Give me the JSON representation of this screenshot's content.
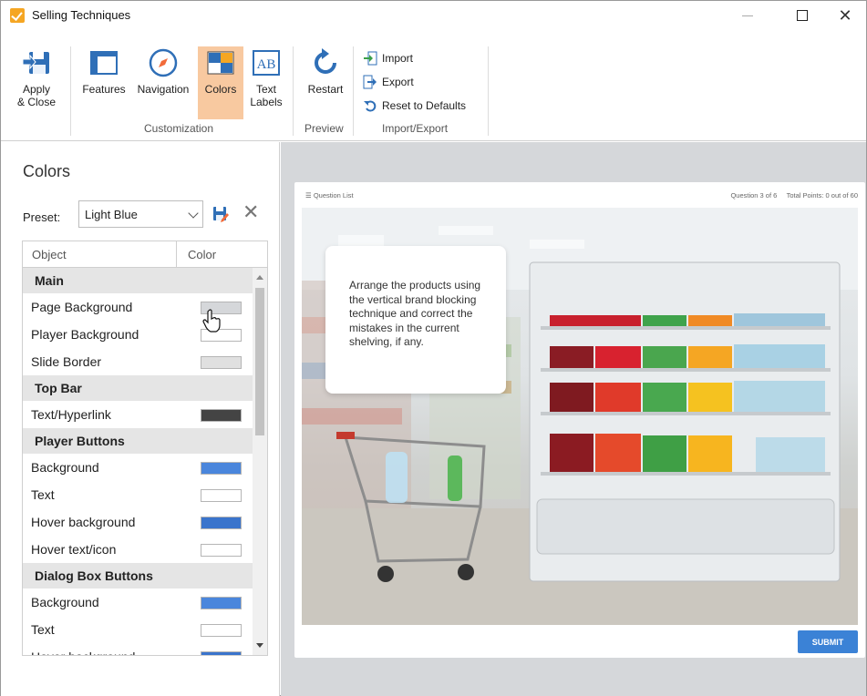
{
  "window": {
    "title": "Selling Techniques"
  },
  "ribbon": {
    "apply_close": "Apply\n& Close",
    "features": "Features",
    "navigation": "Navigation",
    "colors": "Colors",
    "text_labels": "Text\nLabels",
    "restart": "Restart",
    "import": "Import",
    "export": "Export",
    "reset": "Reset to Defaults",
    "groups": {
      "customization": "Customization",
      "preview": "Preview",
      "import_export": "Import/Export"
    }
  },
  "colors_panel": {
    "title": "Colors",
    "preset_label": "Preset:",
    "preset_value": "Light Blue",
    "col_object": "Object",
    "col_color": "Color",
    "rows": [
      {
        "type": "section",
        "label": "Main"
      },
      {
        "type": "item",
        "label": "Page Background",
        "color": "#d5d7da"
      },
      {
        "type": "item",
        "label": "Player Background",
        "color": "#ffffff"
      },
      {
        "type": "item",
        "label": "Slide Border",
        "color": "#e0e0e0"
      },
      {
        "type": "section",
        "label": "Top Bar"
      },
      {
        "type": "item",
        "label": "Text/Hyperlink",
        "color": "#444444"
      },
      {
        "type": "section",
        "label": "Player Buttons"
      },
      {
        "type": "item",
        "label": "Background",
        "color": "#4a86dc"
      },
      {
        "type": "item",
        "label": "Text",
        "color": "#ffffff"
      },
      {
        "type": "item",
        "label": "Hover background",
        "color": "#3a74cc"
      },
      {
        "type": "item",
        "label": "Hover text/icon",
        "color": "#ffffff"
      },
      {
        "type": "section",
        "label": "Dialog Box Buttons"
      },
      {
        "type": "item",
        "label": "Background",
        "color": "#4a86dc"
      },
      {
        "type": "item",
        "label": "Text",
        "color": "#ffffff"
      },
      {
        "type": "item",
        "label": "Hover background",
        "color": "#3a74cc"
      }
    ]
  },
  "preview": {
    "question_list": "Question List",
    "question_info": "Question 3 of 6     Total Points: 0 out of 60",
    "callout": "Arrange the products using the vertical brand blocking technique and correct the mistakes in the current shelving, if any.",
    "submit": "SUBMIT"
  }
}
